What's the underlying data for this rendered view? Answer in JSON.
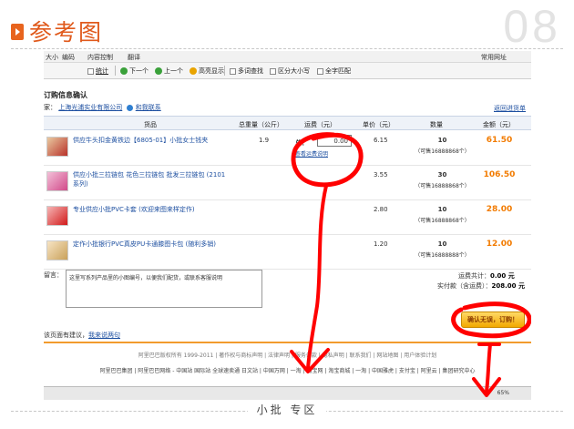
{
  "header": {
    "title": "参考图",
    "number": "08"
  },
  "browser": {
    "menu": [
      "大小",
      "编码",
      "内容控制",
      "翻译"
    ],
    "right_menu": "常用网址",
    "find_bar": {
      "close_label": "统计",
      "next_label": "下一个",
      "prev_label": "上一个",
      "highlight_label": "高亮显示",
      "multi_find_label": "多词查找",
      "case_label": "区分大小写",
      "whole_word_label": "全字匹配"
    }
  },
  "order": {
    "section_title": "订购信息确认",
    "seller_label": "家：",
    "seller_name": "上海光浦实业有限公司",
    "contact_label": "和我联系",
    "back_link": "返回进货单",
    "columns": {
      "product": "货品",
      "weight": "总重量（公斤）",
      "freight": "运费（元）",
      "unit_price": "单价（元）",
      "quantity": "数量",
      "amount": "金额（元）"
    },
    "items": [
      {
        "name": "供应牛头扣金黄铁边【6805-01】小批女士钱夹",
        "weight": "1.9",
        "price": "6.15",
        "qty": "10",
        "available": "（可售16888868个）",
        "amount": "61.50"
      },
      {
        "name": "供应小批三拉链包 花色三拉链包 批发三拉链包 (2101系列)",
        "weight": "",
        "price": "3.55",
        "qty": "30",
        "available": "（可售16888868个）",
        "amount": "106.50"
      },
      {
        "name": "专业供应小批PVC卡套 (欢迎来图来样定作)",
        "weight": "",
        "price": "2.80",
        "qty": "10",
        "available": "（可售16888868个）",
        "amount": "28.00"
      },
      {
        "name": "定作小批银行PVC真皮PU卡通膝图卡包 (随利多销)",
        "weight": "",
        "price": "1.20",
        "qty": "10",
        "available": "（可售16888888个）",
        "amount": "12.00"
      }
    ],
    "freight": {
      "label": "总：",
      "value": "0.00",
      "help_link": "查看运费说明"
    },
    "message": {
      "label": "留言：",
      "text": "这里写系列产品里的小图编号，以便我们配货，或联系客服说明"
    },
    "summary": {
      "freight_total_label": "运费共计：",
      "freight_total": "0.00 元",
      "pay_label": "实付款（含运费）：",
      "pay_total": "208.00 元"
    },
    "confirm_button": "确认无误，订购！",
    "feedback_label": "该页面有建议，",
    "feedback_link": "我来说两句"
  },
  "site_footer": {
    "copyright": "阿里巴巴版权所有 1999-2011 | 著作权与商标声明 | 法律声明 | 服务条款 | 隐私声明 | 联系我们 | 网站地图 | 用户体验计划",
    "links": "阿里巴巴集团 | 阿里巴巴网络 - 中国站 国际站 全球速卖通 日文站 | 中国万网 | 一淘 | 淘宝网 | 淘宝商城 | 一淘 | 中国雅虎 | 支付宝 | 阿里云 | 集团研究中心"
  },
  "status_text": "65%",
  "footer": {
    "caption": "小批 专区"
  },
  "colors": {
    "accent": "#e05a1c",
    "link": "#1d4fa0",
    "amount": "#f27b00",
    "annotation": "#ff0000"
  }
}
